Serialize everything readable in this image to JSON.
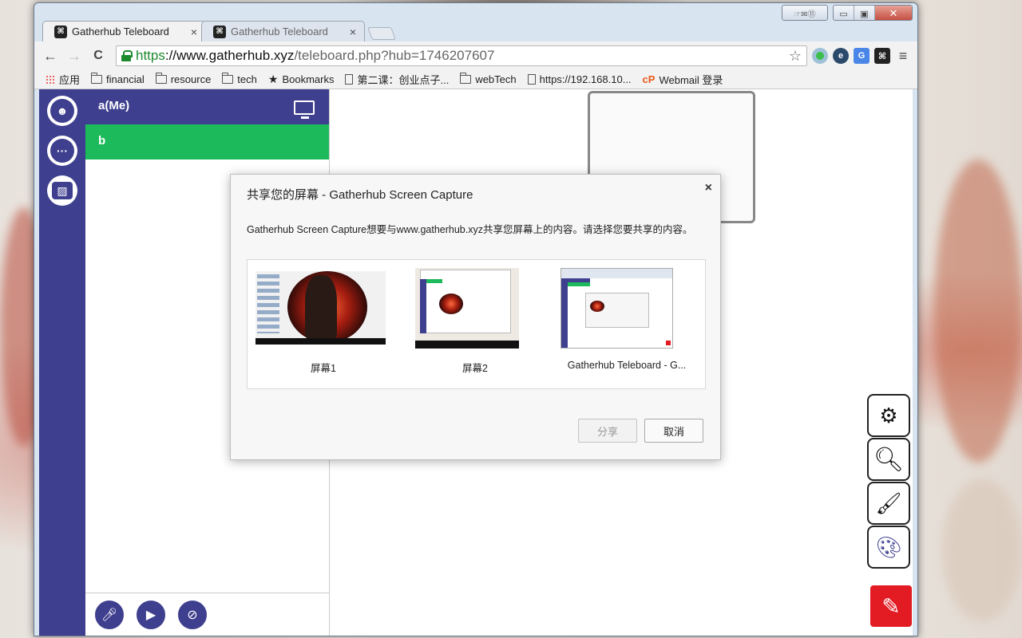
{
  "window": {
    "controls": {
      "extra": "☞✉⑪",
      "minimize": "▭",
      "maximize": "▣",
      "close": "✕"
    }
  },
  "tabs": [
    {
      "title": "Gatherhub Teleboard",
      "active": true,
      "close": "×"
    },
    {
      "title": "Gatherhub Teleboard",
      "active": false,
      "close": "×"
    }
  ],
  "toolbar": {
    "back": "←",
    "forward": "→",
    "reload": "C",
    "url": {
      "scheme": "https",
      "host": "://www.gatherhub.xyz",
      "path": "/teleboard.php?hub=1746207607"
    },
    "star": "☆",
    "menu": "≡"
  },
  "bookmarks": [
    {
      "label": "应用",
      "icon": "apps-icon"
    },
    {
      "label": "financial",
      "icon": "folder-icon"
    },
    {
      "label": "resource",
      "icon": "folder-icon"
    },
    {
      "label": "tech",
      "icon": "folder-icon"
    },
    {
      "label": "Bookmarks",
      "icon": "star-icon"
    },
    {
      "label": "第二课：创业点子...",
      "icon": "page-icon"
    },
    {
      "label": "webTech",
      "icon": "folder-icon"
    },
    {
      "label": "https://192.168.10...",
      "icon": "page-icon"
    },
    {
      "label": "Webmail 登录",
      "icon": "webmail-icon"
    }
  ],
  "users": [
    {
      "name": "a(Me)",
      "color": "#3f3f8f"
    },
    {
      "name": "b",
      "color": "#1dba5c"
    }
  ],
  "dialog": {
    "title": "共享您的屏幕 - Gatherhub Screen Capture",
    "close": "×",
    "message": "Gatherhub Screen Capture想要与www.gatherhub.xyz共享您屏幕上的内容。请选择您要共享的内容。",
    "sources": [
      {
        "label": "屏幕1"
      },
      {
        "label": "屏幕2"
      },
      {
        "label": "Gatherhub Teleboard - G..."
      }
    ],
    "share_label": "分享",
    "cancel_label": "取消"
  },
  "colors": {
    "rail": "#3f3f8f",
    "user_other": "#1dba5c",
    "pen": "#e31b23",
    "url_secure": "#1e8a2e"
  }
}
